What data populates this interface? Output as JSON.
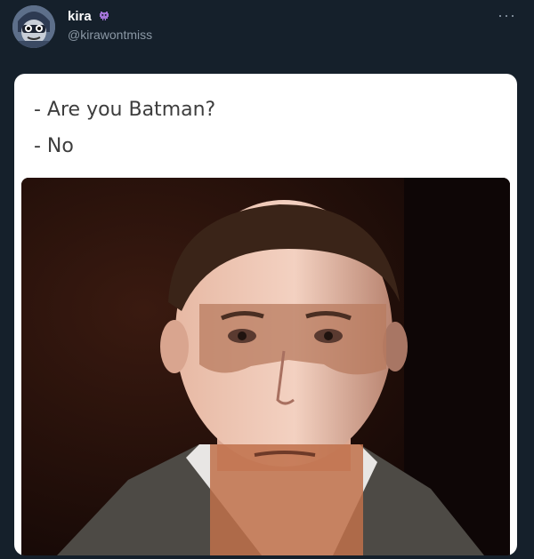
{
  "tweet": {
    "author": {
      "display_name": "kira",
      "handle": "@kirawontmiss",
      "badge_icon": "alien-monster-icon",
      "avatar_icon": "cartoon-avatar-icon"
    },
    "more_icon": "more-options-icon",
    "media": {
      "caption_lines": [
        "- Are you Batman?",
        "- No"
      ],
      "image": "man-in-suit-with-cowl-shaped-shading-photo"
    }
  },
  "colors": {
    "background": "#15202b",
    "name": "#ffffff",
    "handle": "#8b98a5",
    "badge": "#a374d6",
    "card": "#ffffff"
  }
}
